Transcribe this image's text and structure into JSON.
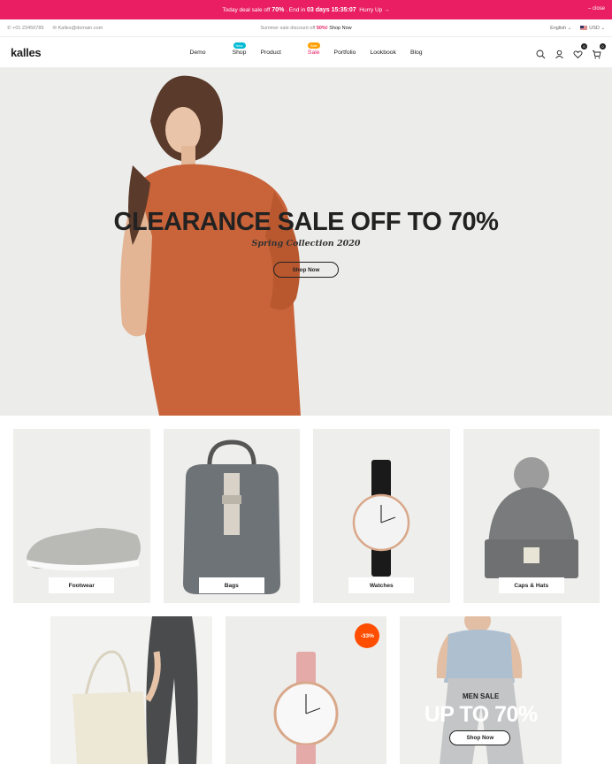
{
  "announcement": {
    "text1": "Today deal sale off",
    "pct": "70%",
    "text2": ". End in",
    "countdown": "03 days 15:35:07",
    "cta": "Hurry Up →",
    "close": "– close"
  },
  "subbar": {
    "phone": "+01 23456789",
    "email": "Kalles@domain.com",
    "promo_text": "Summer sale discount off",
    "promo_pct": "50%!",
    "promo_cta": "Shop Now",
    "language": "English ⌄",
    "currency": "USD ⌄"
  },
  "nav": {
    "logo": "kalles",
    "items": [
      "Demo",
      "Shop",
      "Product",
      "Sale",
      "Portfolio",
      "Lookbook",
      "Blog"
    ],
    "badge_new": "New",
    "badge_sale": "Sale",
    "wishlist_count": "0",
    "cart_count": "0"
  },
  "hero": {
    "title": "CLEARANCE SALE OFF TO 70%",
    "subtitle": "Spring Collection 2020",
    "button": "Shop Now"
  },
  "categories": [
    "Footwear",
    "Bags",
    "Watches",
    "Caps & Hats"
  ],
  "promos": {
    "discount_badge": "-33%",
    "men_label": "MEN SALE",
    "men_title": "UP TO 70%",
    "men_button": "Shop Now"
  },
  "colors": {
    "accent": "#e91e63",
    "badge_new": "#01bad4",
    "badge_sale": "#ff9f00",
    "discount": "#ff4e00"
  }
}
